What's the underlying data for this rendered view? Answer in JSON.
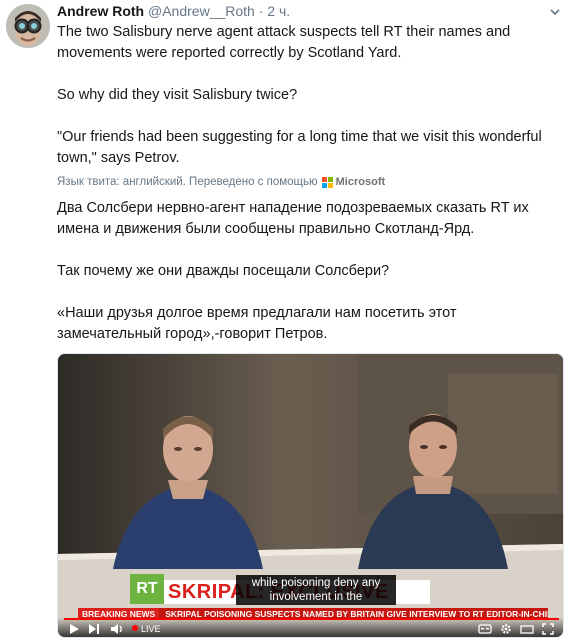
{
  "tweet": {
    "author_name": "Andrew Roth",
    "handle": "@Andrew__Roth",
    "separator": "·",
    "time": "2 ч.",
    "paragraphs": [
      "The two Salisbury nerve agent attack suspects tell RT their names and movements were reported correctly by Scotland Yard.",
      "So why did they visit Salisbury twice?",
      "\"Our friends had been suggesting for a long time that we visit this wonderful town,\" says Petrov."
    ]
  },
  "translation": {
    "note": "Язык твита: английский. Переведено с помощью",
    "provider": "Microsoft",
    "paragraphs": [
      "Два Солсбери нервно-агент нападение подозреваемых сказать RT их имена и движения были сообщены правильно Скотланд-Ярд.",
      "Так почему же они дважды посещали Солсбери?",
      "«Наши друзья долгое время предлагали нам посетить этот замечательный город»,-говорит Петров."
    ]
  },
  "video": {
    "logo": "RT",
    "headline": "SKRIPAL: EXCLUSIVE",
    "subtitle_line1": "while poisoning deny any",
    "subtitle_line2": "involvement in the",
    "ticker_badge": "BREAKING NEWS",
    "ticker_text": "SKRIPAL POISONING SUSPECTS NAMED BY BRITAIN GIVE INTERVIEW TO RT EDITOR-IN-CHIEF",
    "live_label": "LIVE",
    "progress": 1.0
  },
  "icons": {
    "caret": "chevron-down-icon",
    "play": "play-icon",
    "next": "next-icon",
    "volume": "volume-icon",
    "captions": "captions-icon",
    "settings": "gear-icon",
    "fullscreen": "fullscreen-icon"
  },
  "colors": {
    "text": "#14171a",
    "muted": "#657786",
    "rt_red": "#d9201c",
    "rt_green": "#6db33f"
  }
}
